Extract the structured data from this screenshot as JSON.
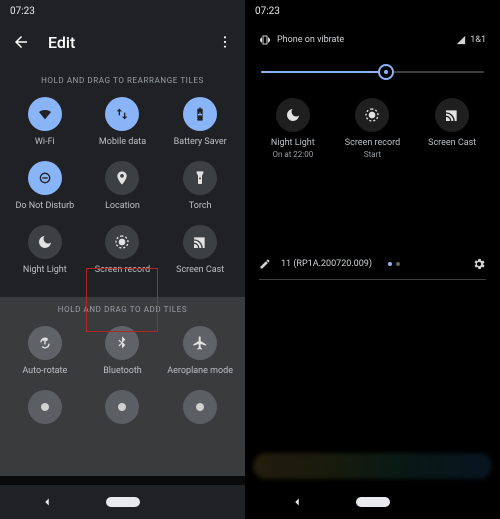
{
  "time": "07:23",
  "left": {
    "title": "Edit",
    "hint_top": "HOLD AND DRAG TO REARRANGE TILES",
    "hint_bottom": "HOLD AND DRAG TO ADD TILES",
    "tiles": [
      {
        "label": "Wi-Fi"
      },
      {
        "label": "Mobile data"
      },
      {
        "label": "Battery Saver"
      },
      {
        "label": "Do Not Disturb"
      },
      {
        "label": "Location"
      },
      {
        "label": "Torch"
      },
      {
        "label": "Night Light"
      },
      {
        "label": "Screen record"
      },
      {
        "label": "Screen Cast"
      }
    ],
    "add_tiles": [
      {
        "label": "Auto-rotate"
      },
      {
        "label": "Bluetooth"
      },
      {
        "label": "Aeroplane mode"
      }
    ]
  },
  "right": {
    "ring_status": "Phone on vibrate",
    "signal_label": "1&1",
    "brightness_pct": 56,
    "tiles": [
      {
        "label": "Night Light",
        "sub": "On at 22:00"
      },
      {
        "label": "Screen record",
        "sub": "Start"
      },
      {
        "label": "Screen Cast",
        "sub": ""
      }
    ],
    "build": "11 (RP1A.200720.009)"
  }
}
